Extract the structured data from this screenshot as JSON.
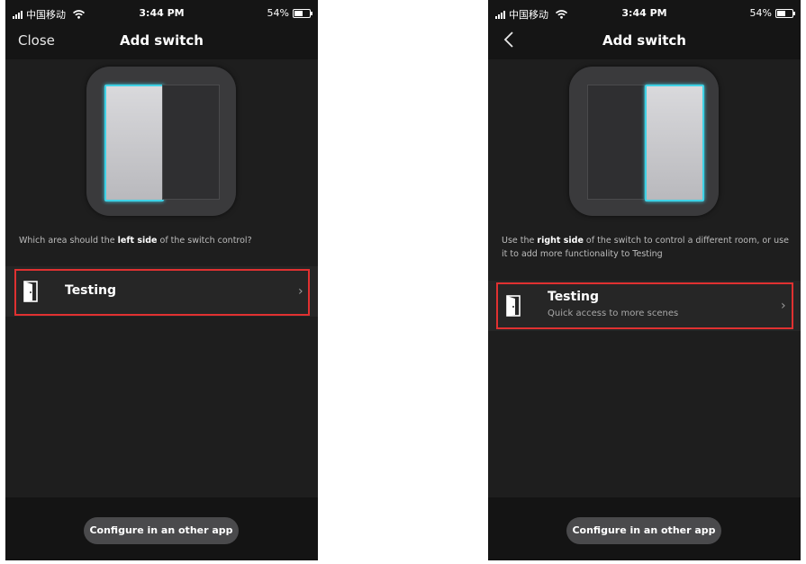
{
  "status_bar": {
    "carrier": "中国移动",
    "time": "3:44 PM",
    "battery": "54%"
  },
  "screens": [
    {
      "nav_left": "Close",
      "title": "Add switch",
      "active_side": "left",
      "question_pre": "Which area should the ",
      "question_bold": "left side",
      "question_post": " of the switch control?",
      "room_name": "Testing",
      "room_sub": "",
      "configure_button": "Configure in an other app"
    },
    {
      "nav_left_icon": "back-chevron-icon",
      "title": "Add switch",
      "active_side": "right",
      "question_pre": "Use the ",
      "question_bold": "right side",
      "question_post": " of the switch to control a different room, or use it to add more functionality to Testing",
      "room_name": "Testing",
      "room_sub": "Quick access to more scenes",
      "configure_button": "Configure in an other app"
    }
  ],
  "colors": {
    "background": "#1e1e1e",
    "highlight_box": "#e03131",
    "switch_glow": "#3fd2e6"
  }
}
